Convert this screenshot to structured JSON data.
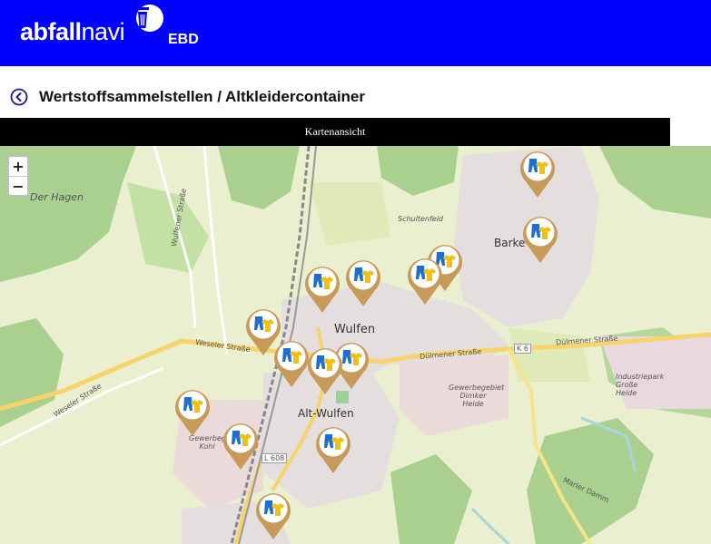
{
  "header": {
    "logo_bold": "abfall",
    "logo_light": "navi",
    "org": "EBD",
    "brand_color": "#0000ff"
  },
  "page": {
    "title": "Wertstoffsammelstellen / Altkleidercontainer",
    "back_icon": "chevron-left-circle-icon"
  },
  "view_toggle": {
    "label": "Kartenansicht"
  },
  "map": {
    "zoom_in": "+",
    "zoom_out": "−",
    "labels": {
      "der_hagen": "Der Hagen",
      "wulfen": "Wulfen",
      "alt_wulfen": "Alt-Wulfen",
      "barkenberg": "Barke",
      "schultenfeld": "Schultenfeld",
      "weseler_str_1": "Weseler Straße",
      "weseler_str_2": "Weseler Straße",
      "wulfener_str": "Wulfener Straße",
      "duelmener_str_1": "Dülmener Straße",
      "duelmener_str_2": "Dülmener Straße",
      "k6": "K 6",
      "l608": "L 608",
      "gewerbegebiet_dimker": "Gewerbegebiet Dimker Heide",
      "industriepark": "Industriepark Große Heide",
      "gewerbegebiet_kohl": "Gewerbege Kohl",
      "marler_damm": "Marler Damm"
    },
    "marker_icon": "clothing-container-icon",
    "marker_count": 14
  }
}
